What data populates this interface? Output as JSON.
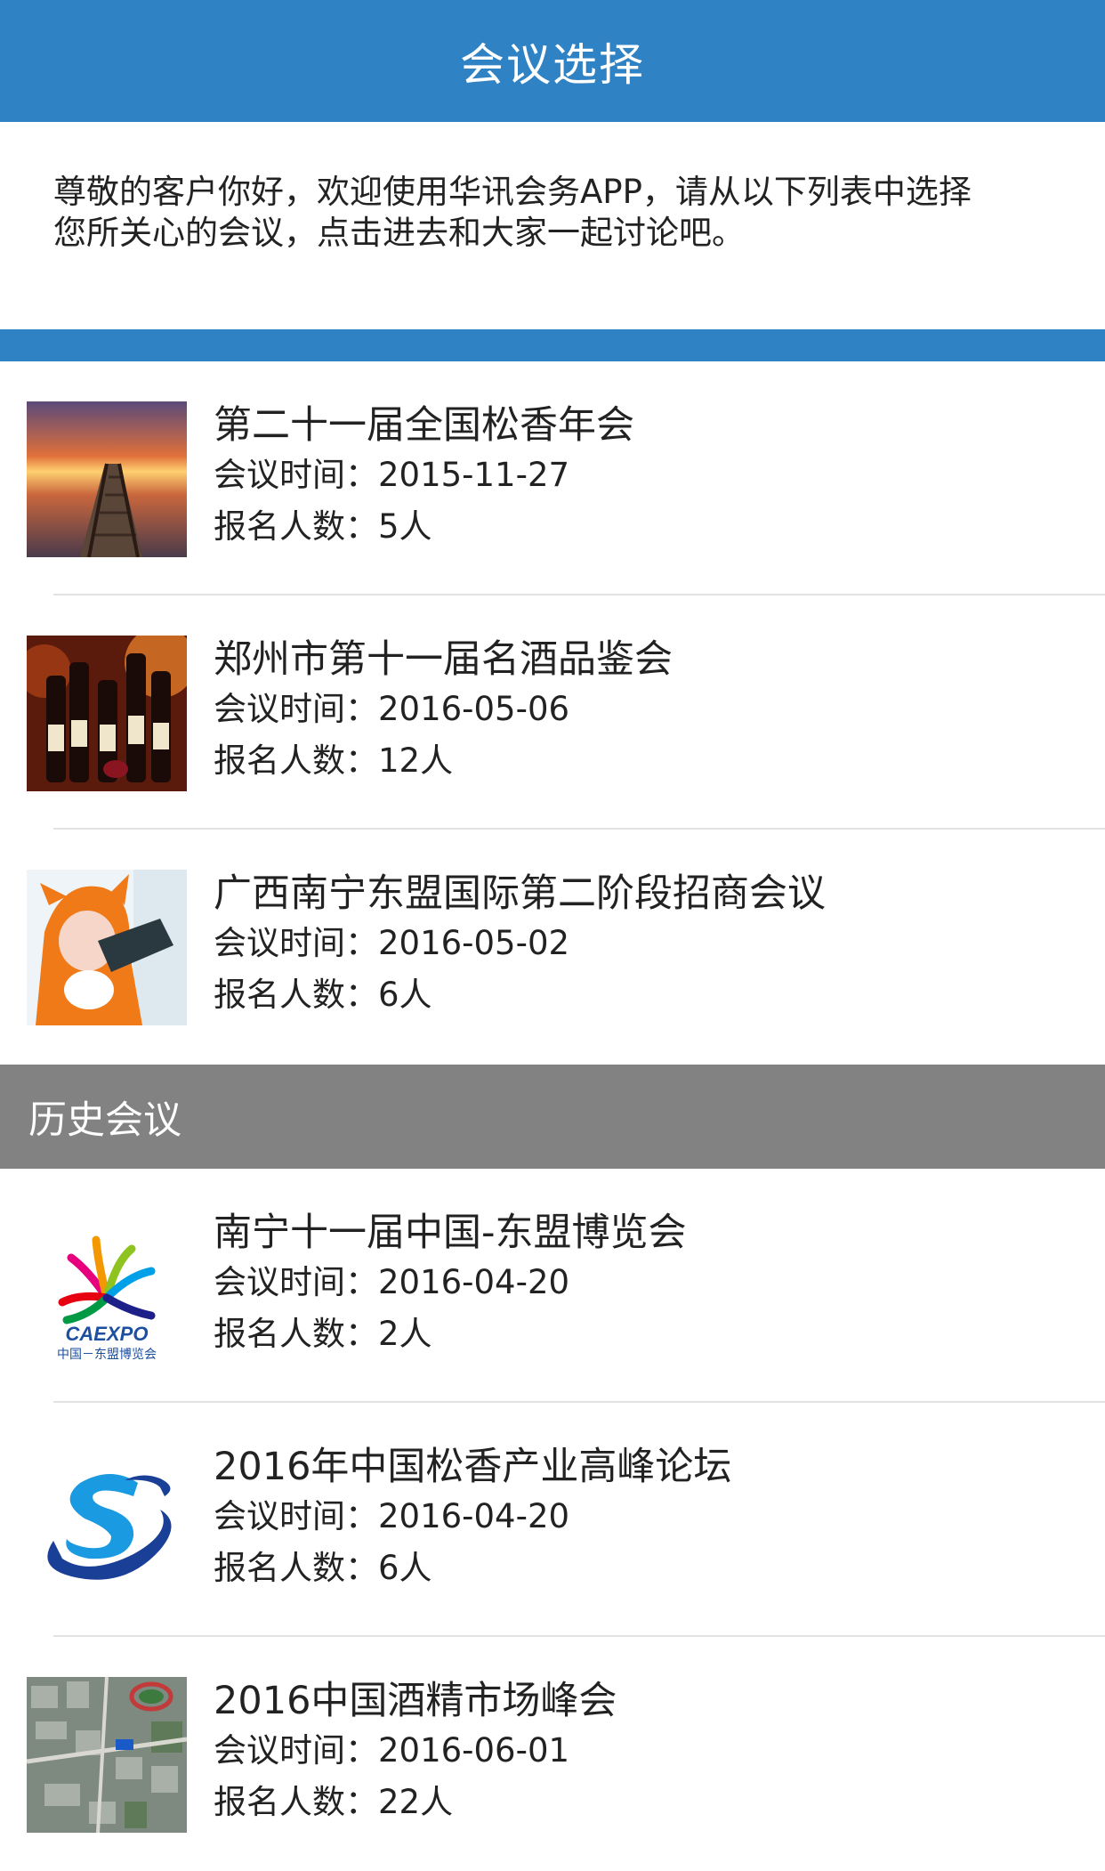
{
  "header": {
    "title": "会议选择"
  },
  "intro": {
    "line1": "尊敬的客户你好，欢迎使用华讯会务APP，请从以下列表中选择",
    "line2": "您所关心的会议，点击进去和大家一起讨论吧。"
  },
  "current_meetings": [
    {
      "title": "第二十一届全国松香年会",
      "time_label": "会议时间：",
      "time": "2015-11-27",
      "count_label": "报名人数：",
      "count": "5人",
      "thumb_icon": "pier-sunset-photo"
    },
    {
      "title": "郑州市第十一届名酒品鉴会",
      "time_label": "会议时间：",
      "time": "2016-05-06",
      "count_label": "报名人数：",
      "count": "12人",
      "thumb_icon": "wine-bottles-photo"
    },
    {
      "title": "广西南宁东盟国际第二阶段招商会议",
      "time_label": "会议时间：",
      "time": "2016-05-02",
      "count_label": "报名人数：",
      "count": "6人",
      "thumb_icon": "orange-hood-person-photo"
    }
  ],
  "history": {
    "section_title": "历史会议",
    "meetings": [
      {
        "title": "南宁十一届中国-东盟博览会",
        "time_label": "会议时间：",
        "time": "2016-04-20",
        "count_label": "报名人数：",
        "count": "2人",
        "thumb_icon": "caexpo-logo",
        "logo_text": "CAEXPO",
        "logo_subtext": "中国－东盟博览会"
      },
      {
        "title": "2016年中国松香产业高峰论坛",
        "time_label": "会议时间：",
        "time": "2016-04-20",
        "count_label": "报名人数：",
        "count": "6人",
        "thumb_icon": "blue-s-swirl-logo"
      },
      {
        "title": "2016中国酒精市场峰会",
        "time_label": "会议时间：",
        "time": "2016-06-01",
        "count_label": "报名人数：",
        "count": "22人",
        "thumb_icon": "aerial-map-photo"
      }
    ]
  },
  "colors": {
    "header_blue": "#2f82c4",
    "history_gray": "#828282",
    "divider": "#e2e2e2"
  }
}
